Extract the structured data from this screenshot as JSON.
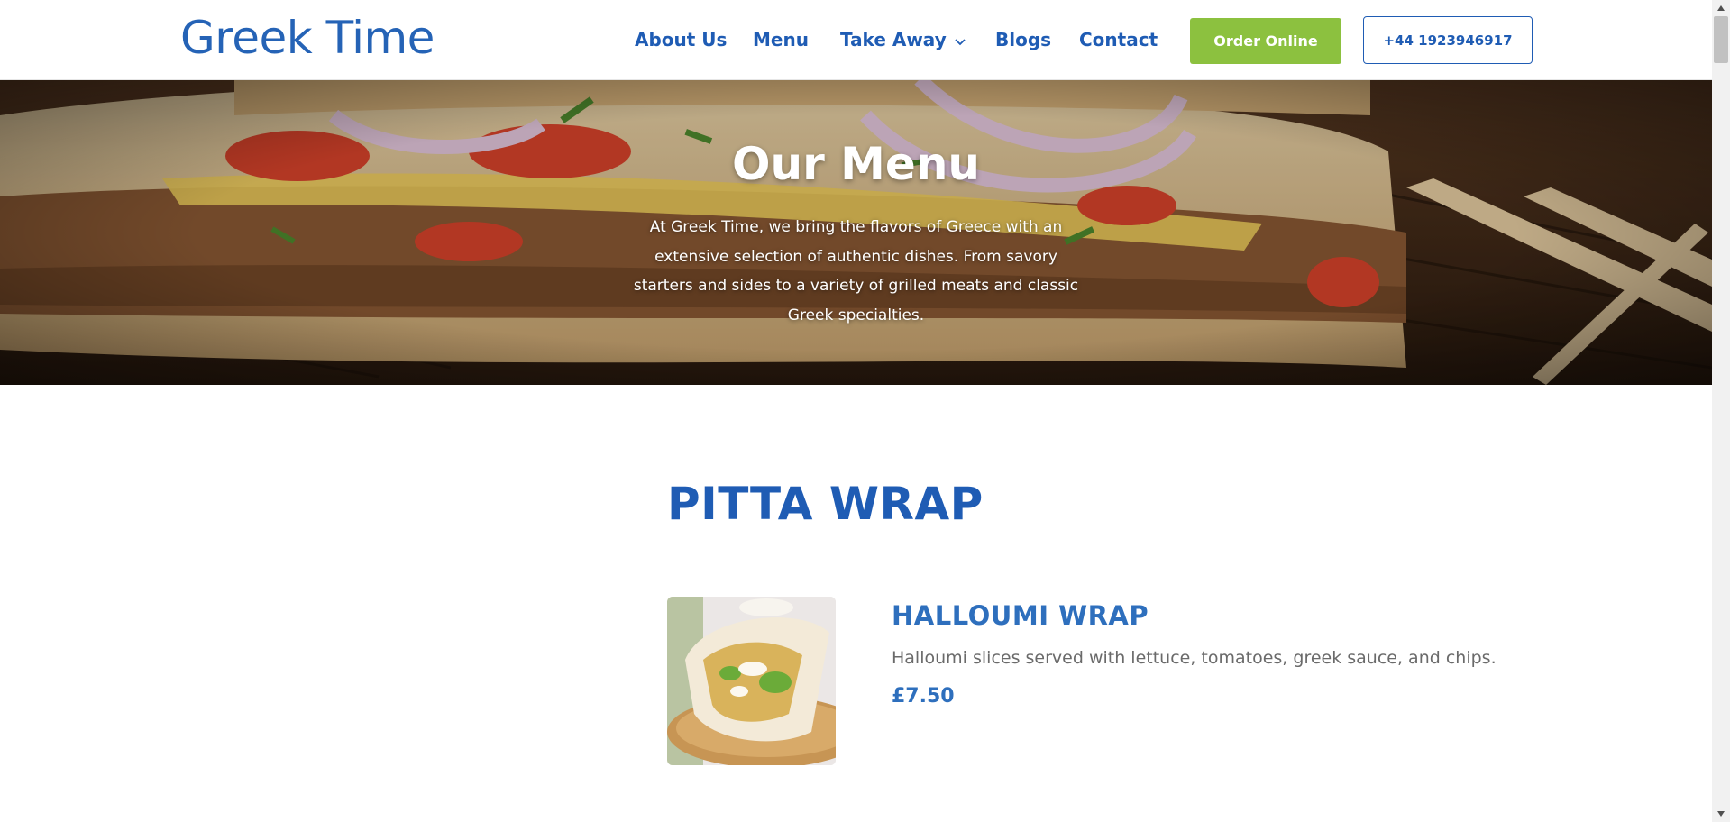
{
  "header": {
    "logo": "Greek Time",
    "nav": [
      {
        "label": "About Us"
      },
      {
        "label": "Menu"
      },
      {
        "label": "Take Away"
      },
      {
        "label": "Blogs"
      },
      {
        "label": "Contact"
      }
    ],
    "take_away_icon": "chevron-down-icon",
    "order_button": "Order Online",
    "phone_button": "+44 1923946917"
  },
  "hero": {
    "title": "Our Menu",
    "description": "At Greek Time, we bring the flavors of Greece with an extensive selection of authentic dishes. From savory starters and sides to a variety of grilled meats and classic Greek specialties."
  },
  "section": {
    "title": "PITTA WRAP",
    "items": [
      {
        "name": "HALLOUMI WRAP",
        "description": "Halloumi slices served with lettuce, tomatoes, greek sauce, and chips.",
        "price": "£7.50"
      }
    ]
  },
  "colors": {
    "brand_blue": "#1f5cb4",
    "order_green": "#8cc13f",
    "item_blue": "#2e6fbd",
    "text_grey": "#6a6a6a"
  }
}
